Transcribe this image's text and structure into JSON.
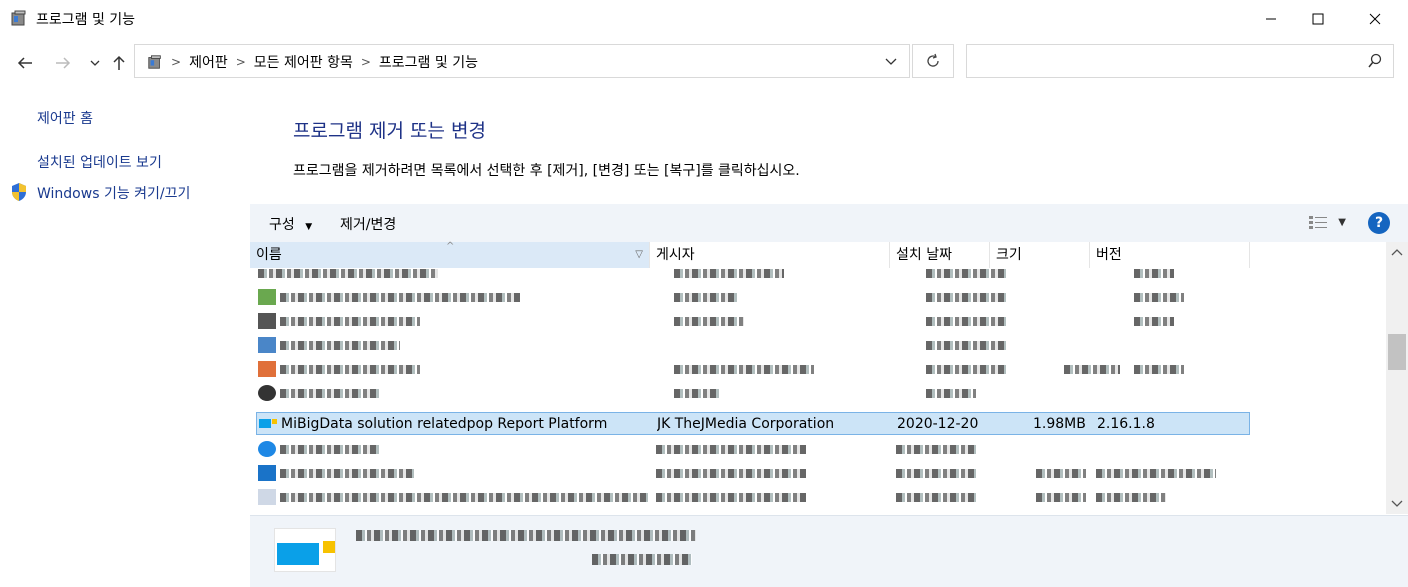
{
  "window": {
    "title": "프로그램 및 기능"
  },
  "address": {
    "crumbs": [
      "제어판",
      "모든 제어판 항목",
      "프로그램 및 기능"
    ],
    "search_placeholder": ""
  },
  "sidebar": {
    "items": [
      {
        "label": "제어판 홈"
      },
      {
        "label": "설치된 업데이트 보기"
      },
      {
        "label": "Windows 기능 켜기/끄기"
      }
    ]
  },
  "main": {
    "title": "프로그램 제거 또는 변경",
    "description": "프로그램을 제거하려면 목록에서 선택한 후 [제거], [변경] 또는 [복구]를 클릭하십시오."
  },
  "toolbar": {
    "organize_label": "구성",
    "uninstall_change_label": "제거/변경"
  },
  "columns": [
    "이름",
    "게시자",
    "설치 날짜",
    "크기",
    "버전"
  ],
  "selected_row": {
    "name": "MiBigData solution relatedpop Report Platform",
    "publisher": "JK TheJMedia Corporation",
    "installed": "2020-12-20",
    "size": "1.98MB",
    "version": "2.16.1.8"
  },
  "colors": {
    "accent": "#1e3287",
    "link": "#1a3a8f",
    "selection": "#cce4f7",
    "toolbar_bg": "#f0f4f9",
    "help_badge": "#1565c0"
  }
}
